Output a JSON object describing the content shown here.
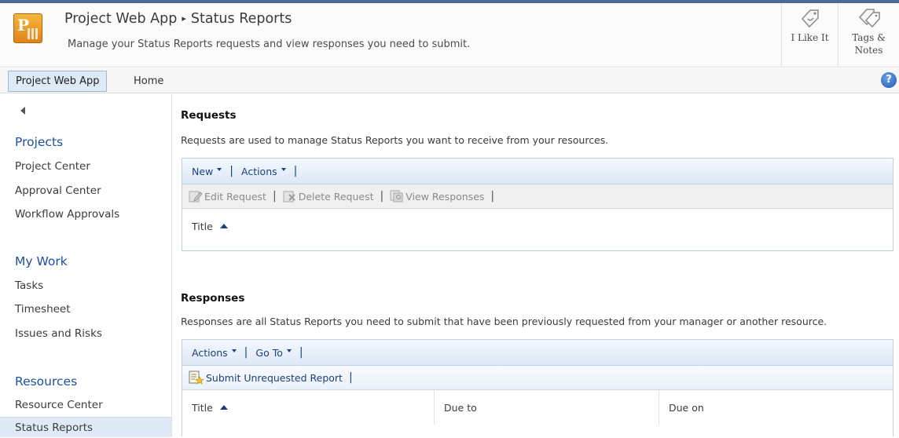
{
  "header": {
    "site_title": "Project Web App",
    "page_title": "Status Reports",
    "separator": "▸",
    "description": "Manage your Status Reports requests and view responses you need to submit.",
    "like_label": "I Like It",
    "tags_label_line1": "Tags &",
    "tags_label_line2": "Notes"
  },
  "topnav": {
    "site_tab": "Project Web App",
    "home": "Home",
    "help": "?"
  },
  "leftnav": {
    "sections": [
      {
        "heading": "Projects",
        "items": [
          "Project Center",
          "Approval Center",
          "Workflow Approvals"
        ]
      },
      {
        "heading": "My Work",
        "items": [
          "Tasks",
          "Timesheet",
          "Issues and Risks"
        ]
      },
      {
        "heading": "Resources",
        "items": [
          "Resource Center",
          "Status Reports"
        ]
      }
    ],
    "selected_item": "Status Reports"
  },
  "requests": {
    "title": "Requests",
    "description": "Requests are used to manage Status Reports you want to receive from your resources.",
    "toolbar": {
      "new_label": "New",
      "actions_label": "Actions"
    },
    "actions": {
      "edit": "Edit Request",
      "delete": "Delete Request",
      "view": "View Responses"
    },
    "columns": [
      "Title"
    ],
    "sort_column": "Title",
    "sort_direction": "ascending"
  },
  "responses": {
    "title": "Responses",
    "description": "Responses are all Status Reports you need to submit that have been previously requested from your manager or another resource.",
    "toolbar": {
      "actions_label": "Actions",
      "goto_label": "Go To"
    },
    "actions": {
      "submit": "Submit Unrequested Report"
    },
    "columns": [
      "Title",
      "Due to",
      "Due on"
    ],
    "sort_column": "Title",
    "sort_direction": "ascending"
  },
  "colors": {
    "nav_heading": "#1f4fa0",
    "toolbar_text": "#1e3f78",
    "selected_bg": "#dfeaf7",
    "logo_orange": "#f0a030"
  },
  "icons": {
    "logo": "project-logo-icon",
    "like": "like-tag-icon",
    "tags": "tags-notes-icon",
    "help": "help-icon",
    "edit": "edit-request-icon",
    "delete": "delete-request-icon",
    "view": "view-responses-icon",
    "submit": "submit-report-icon"
  }
}
